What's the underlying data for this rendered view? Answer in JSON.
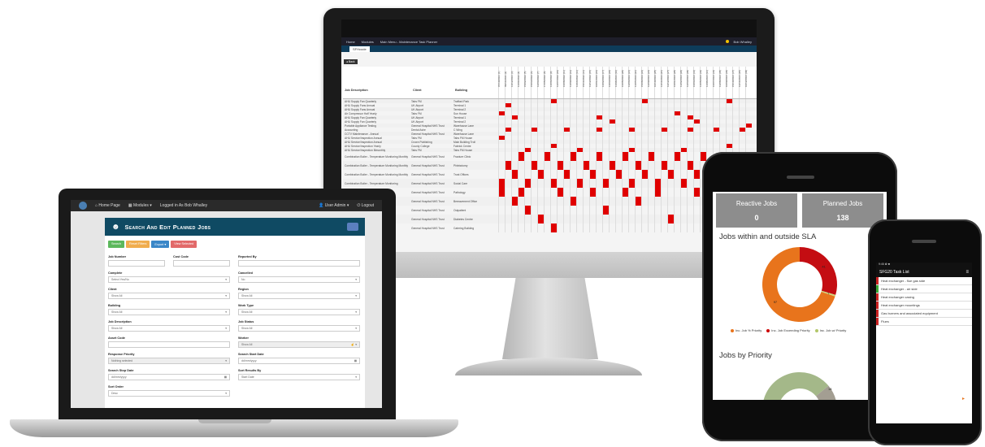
{
  "monitor": {
    "nav": {
      "home": "Home",
      "modules": "Modules",
      "title": "Main Menu - Maintenance Task Planner",
      "user": "Bob Whalley"
    },
    "tab_label": "SFHcode",
    "back_label": "◂ Back",
    "columns": {
      "job": "Job Description",
      "client": "Client",
      "building": "Building"
    },
    "dates": [
      "07/10/2021 (1)",
      "09/11/2021 (2)",
      "14/12/2021 (3)",
      "11/01/2022 (4)",
      "15/02/2022 (5)",
      "15/03/2022 (6)",
      "12/04/2022 (7)",
      "17/05/2022 (8)",
      "14/06/2022 (9)",
      "12/07/2022 (10)",
      "16/08/2022 (11)",
      "13/09/2022 (12)",
      "11/10/2022 (13)",
      "15/11/2022 (14)",
      "13/12/2022 (15)",
      "10/01/2023 (16)",
      "14/02/2023 (17)",
      "14/03/2023 (18)",
      "11/04/2023 (19)",
      "16/05/2023 (20)",
      "13/06/2023 (21)",
      "11/07/2023 (22)",
      "15/08/2023 (23)",
      "12/09/2023 (24)",
      "10/10/2023 (25)",
      "14/11/2023 (26)",
      "12/12/2023 (27)",
      "16/01/2024 (28)",
      "13/02/2024 (29)",
      "12/03/2024 (30)",
      "16/04/2024 (31)",
      "14/05/2024 (32)",
      "11/06/2024 (33)",
      "16/07/2024 (34)",
      "13/08/2024 (35)",
      "10/09/2024 (36)",
      "15/10/2024 (37)",
      "12/11/2024 (38)",
      "10/12/2024 (39)"
    ],
    "rows": [
      {
        "job": "AHU Supply Fan Quarterly",
        "client": "Tabs FM",
        "building": "Trafford Park",
        "on": [
          8,
          22,
          35
        ]
      },
      {
        "job": "AHU Supply Fans Annual",
        "client": "UK Airport",
        "building": "Terminal 1",
        "on": [
          1
        ]
      },
      {
        "job": "AHU Supply Fans Annual",
        "client": "UK Airport",
        "building": "Terminal 2",
        "on": []
      },
      {
        "job": "Air Compressor Half Yearly",
        "client": "Tabs FM",
        "building": "Sun House",
        "on": [
          0,
          27
        ]
      },
      {
        "job": "AHU Supply Fan Quarterly",
        "client": "UK Airport",
        "building": "Terminal 1",
        "on": [
          2,
          15,
          29
        ]
      },
      {
        "job": "AHU Supply Fan Quarterly",
        "client": "UK Airport",
        "building": "Terminal 2",
        "on": [
          17,
          30
        ]
      },
      {
        "job": "Portable Appliance Testing",
        "client": "General Hospital NHS Trust",
        "building": "Warehouse Lane",
        "on": [
          38
        ]
      },
      {
        "job": "Accounting",
        "client": "Dental Ashe",
        "building": "C Wing",
        "on": [
          1,
          5,
          10,
          15,
          20,
          25,
          29,
          33,
          37
        ]
      },
      {
        "job": "CCTV Maintenance - Annual",
        "client": "General Hospital NHS Trust",
        "building": "Warehouse Lane",
        "on": []
      },
      {
        "job": "AHU Service/Inspection Annual",
        "client": "Tabs FM",
        "building": "Tabs FM House",
        "on": [
          0
        ]
      },
      {
        "job": "AHU Service/Inspection Annual",
        "client": "Crown Publishing",
        "building": "Main Building Troll",
        "on": []
      },
      {
        "job": "AHU Service/Inspection Yearly",
        "client": "County College",
        "building": "Fabrick Centre",
        "on": [
          8,
          35
        ]
      },
      {
        "job": "AHU Service/Inspection Bimonthly",
        "client": "Tabs FM",
        "building": "Tabs FM House",
        "on": [
          4,
          12,
          20,
          28
        ]
      },
      {
        "job": "Combination Boiler - Temperature Monitoring Monthly",
        "client": "General Hospital NHS Trust",
        "building": "Fracture Clinic",
        "tall": true,
        "on": [
          3,
          7,
          11,
          15,
          19,
          23,
          27,
          31,
          35
        ]
      },
      {
        "job": "Combination Boiler - Temperature Monitoring Monthly",
        "client": "General Hospital NHS Trust",
        "building": "Phlebotomy",
        "tall": true,
        "on": [
          1,
          5,
          9,
          13,
          17,
          21,
          25,
          29,
          33,
          37
        ]
      },
      {
        "job": "Combination Boiler - Temperature Monitoring Monthly",
        "client": "General Hospital NHS Trust",
        "building": "Trust Offices",
        "tall": true,
        "on": [
          2,
          6,
          10,
          14,
          18,
          22,
          26,
          30,
          34,
          38
        ]
      },
      {
        "job": "Combination Boiler - Temperature Monitoring",
        "client": "General Hospital NHS Trust",
        "building": "Social Care",
        "tall": true,
        "on": [
          0,
          4,
          8,
          12,
          16,
          20,
          24,
          28,
          32,
          36
        ]
      },
      {
        "job": "",
        "client": "General Hospital NHS Trust",
        "building": "Pathology",
        "tall": true,
        "on": [
          0,
          3,
          9,
          14,
          19,
          24,
          30
        ]
      },
      {
        "job": "",
        "client": "General Hospital NHS Trust",
        "building": "Bereavement Office",
        "tall": true,
        "on": [
          2,
          11,
          21
        ]
      },
      {
        "job": "",
        "client": "General Hospital NHS Trust",
        "building": "Outpatient",
        "tall": true,
        "on": [
          4,
          16
        ]
      },
      {
        "job": "",
        "client": "General Hospital NHS Trust",
        "building": "Diabetes Centre",
        "tall": true,
        "on": [
          6,
          26
        ]
      },
      {
        "job": "",
        "client": "General Hospital NHS Trust",
        "building": "Catering Building",
        "tall": true,
        "on": [
          8
        ]
      }
    ]
  },
  "laptop": {
    "nav": {
      "home": "Home Page",
      "modules": "Modules",
      "logged": "Logged in As Bob Whalley",
      "user": "User Admin",
      "logout": "Logout"
    },
    "form_title": "Search And Edit Planned Jobs",
    "buttons": [
      {
        "label": "Search",
        "color": "#5cb85c"
      },
      {
        "label": "Reset Filters",
        "color": "#f0ad4e"
      },
      {
        "label": "Export ▾",
        "color": "#3a87c8"
      },
      {
        "label": "View Selected",
        "color": "#e26a6a"
      }
    ],
    "fields": {
      "job_number": {
        "label": "Job Number",
        "value": ""
      },
      "cost_code": {
        "label": "Cost Code",
        "value": ""
      },
      "reported_by": {
        "label": "Reported By",
        "value": ""
      },
      "complete": {
        "label": "Complete",
        "value": "Select Yes/No"
      },
      "cancelled": {
        "label": "Cancelled",
        "value": "No"
      },
      "client": {
        "label": "Client",
        "value": "Show All"
      },
      "region": {
        "label": "Region",
        "value": "Show All"
      },
      "building": {
        "label": "Building",
        "value": "Show All"
      },
      "work_type": {
        "label": "Work Type",
        "value": "Show All"
      },
      "job_description": {
        "label": "Job Description",
        "value": "Show All"
      },
      "job_status": {
        "label": "Job Status",
        "value": "Show All"
      },
      "asset_code": {
        "label": "Asset Code",
        "value": ""
      },
      "worker": {
        "label": "Worker",
        "value": "Show All"
      },
      "response_priority": {
        "label": "Response Priority",
        "value": "Nothing selected"
      },
      "search_start": {
        "label": "Search Start Date",
        "value": "dd/mm/yyyy"
      },
      "search_stop": {
        "label": "Search Stop Date",
        "value": "dd/mm/yyyy"
      },
      "sort_by": {
        "label": "Sort Results By",
        "value": "Start Date"
      },
      "sort_order": {
        "label": "Sort Order",
        "value": "Desc"
      }
    }
  },
  "tablet": {
    "reactive_label": "Reactive Jobs",
    "reactive_value": "0",
    "planned_label": "Planned Jobs",
    "planned_value": "138",
    "sla_title": "Jobs within and outside SLA",
    "priority_title": "Jobs by Priority",
    "sla_values": {
      "within": 97,
      "exceeding": 41,
      "no_priority": 1
    },
    "donut_labels": {
      "within": "97",
      "exceeding": "41",
      "no_priority": "1"
    },
    "priority_label": "14",
    "legend": [
      {
        "label": "Inc. Job % Priority",
        "color": "#e8741c"
      },
      {
        "label": "Inc. Job Exceeding Priority",
        "color": "#cc0000"
      },
      {
        "label": "Inc. Job w/ Priority",
        "color": "#b3c76a"
      }
    ],
    "colors": {
      "within": "#e8741c",
      "exceeding": "#c40d12",
      "no_priority": "#cfd77a",
      "priority_a": "#a4b889",
      "priority_b": "#a39e92"
    }
  },
  "phone": {
    "status": "9:46 ✿ ■",
    "title": "SFG20 Task List",
    "tasks": [
      {
        "label": "Heat exchanger - flue gas side",
        "color": "#cc2222"
      },
      {
        "label": "Heat exchanger - air side",
        "color": "#3aa835"
      },
      {
        "label": "Heat exchanger casing",
        "color": "#cc2222"
      },
      {
        "label": "Heat exchanger mountings",
        "color": "#cc2222"
      },
      {
        "label": "Gas burners and associated equipment",
        "color": "#cc2222"
      },
      {
        "label": "Flues",
        "color": "#cc2222"
      }
    ]
  }
}
